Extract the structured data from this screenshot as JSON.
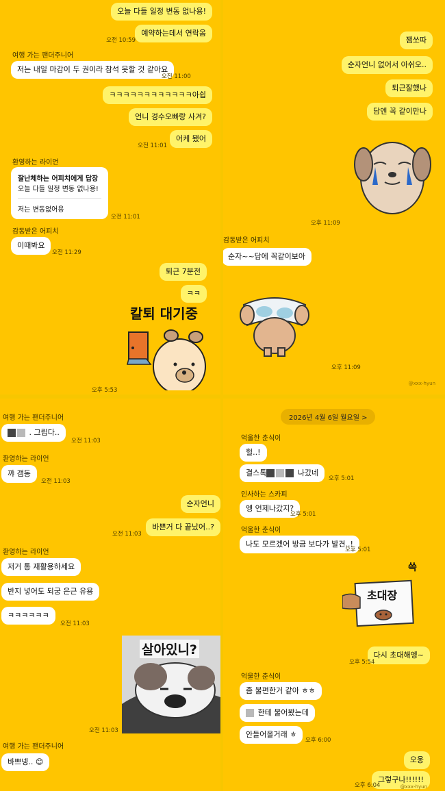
{
  "panel1": {
    "m1": "오늘 다들 일정 변동 없나용!",
    "m2": "예약하는데서 연락옴",
    "t1": "오전 10:59",
    "sender1": "여행 가는 팬더주니어",
    "m3": "저는 내일 마감이 두 권이라 참석 못할 것 같아요",
    "t2": "오전 11:00",
    "m4": "ㅋㅋㅋㅋㅋㅋㅋㅋㅋㅋㅋㅋ아쉽",
    "m5": "언니 경수오빠랑 사겨?",
    "m6": "어케 됐어",
    "t3": "오전 11:01",
    "sender2": "환영하는 라이언",
    "reply_title": "잘난체하는 어피치에게 답장",
    "reply_quote": "오늘 다들 일정 변동 없나용!",
    "reply_body": "저는 변동없어용",
    "t4": "오전 11:01",
    "sender3": "감동받은 어피치",
    "m7": "이때봐요",
    "t5": "오전 11:29",
    "m8": "퇴근 7분전",
    "m9": "ㅋㅋ",
    "sticker_text": "칼퇴 대기중",
    "t6": "오후 5:53"
  },
  "panel2": {
    "m1": "잼쏘따",
    "m2": "순자언니 없어서 아쉬오..",
    "m3": "퇴근잘했나",
    "m4": "담엔 꼭 같이만나",
    "t1": "오후 11:09",
    "sender1": "감동받은 어피치",
    "m5": "순자~~담에 꼭같이보아",
    "t2": "오후 11:09",
    "watermark": "@xxx-hyun"
  },
  "panel3": {
    "sender1": "여행 가는 팬더주니어",
    "m1": ". 그립다..",
    "t1": "오전 11:03",
    "sender2": "환영하는 라이언",
    "m2": "꺄 갬동",
    "t2": "오전 11:03",
    "m3": "순자언니",
    "m4": "바쁜거 다 끝났어..?",
    "t3": "오전 11:03",
    "sender3": "환영하는 라이언",
    "m5": "저거 통 재활용하세요",
    "m6": "반지 넣어도 되궁 은근 유용",
    "m7": "ㅋㅋㅋㅋㅋㅋ",
    "t4": "오전 11:03",
    "sticker_text": "살아있니?",
    "t5": "오전 11:03",
    "sender4": "여행 가는 팬더주니어",
    "m8": "바쁘넹..",
    "emoji": "😊"
  },
  "panel4": {
    "date": "2026년 4월 6일 월요일 >",
    "sender1": "억울한 춘식이",
    "m1": "헐..!",
    "m2_a": "결스톡",
    "m2_b": "나갔네",
    "t1": "오후 5:01",
    "sender2": "인사하는 스카피",
    "m3": "엥 언제나갔지?",
    "t2": "오후 5:01",
    "sender3": "억울한 춘식이",
    "m4": "나도 모르겠어 방금 보다가 발견..!",
    "t3": "오후 5:01",
    "sticker_mark": "쓱",
    "sticker_text": "초대장",
    "m5": "다시 초대해엥~",
    "t4": "오후 5:54",
    "sender4": "억울한 춘식이",
    "m6": "좀 불편한거 같아 ㅎㅎ",
    "m7": "한테 물어봤는데",
    "m8": "안들어올거래 ㅎ",
    "t5": "오후 6:00",
    "m9": "오옹",
    "m10": "그렇구나!!!!!!",
    "t6": "오후 6:04",
    "watermark": "@xxx-hyun"
  },
  "colors": {
    "background": "#ffc500",
    "incoming_bubble": "#ffffff",
    "outgoing_bubble": "#fff36a"
  }
}
